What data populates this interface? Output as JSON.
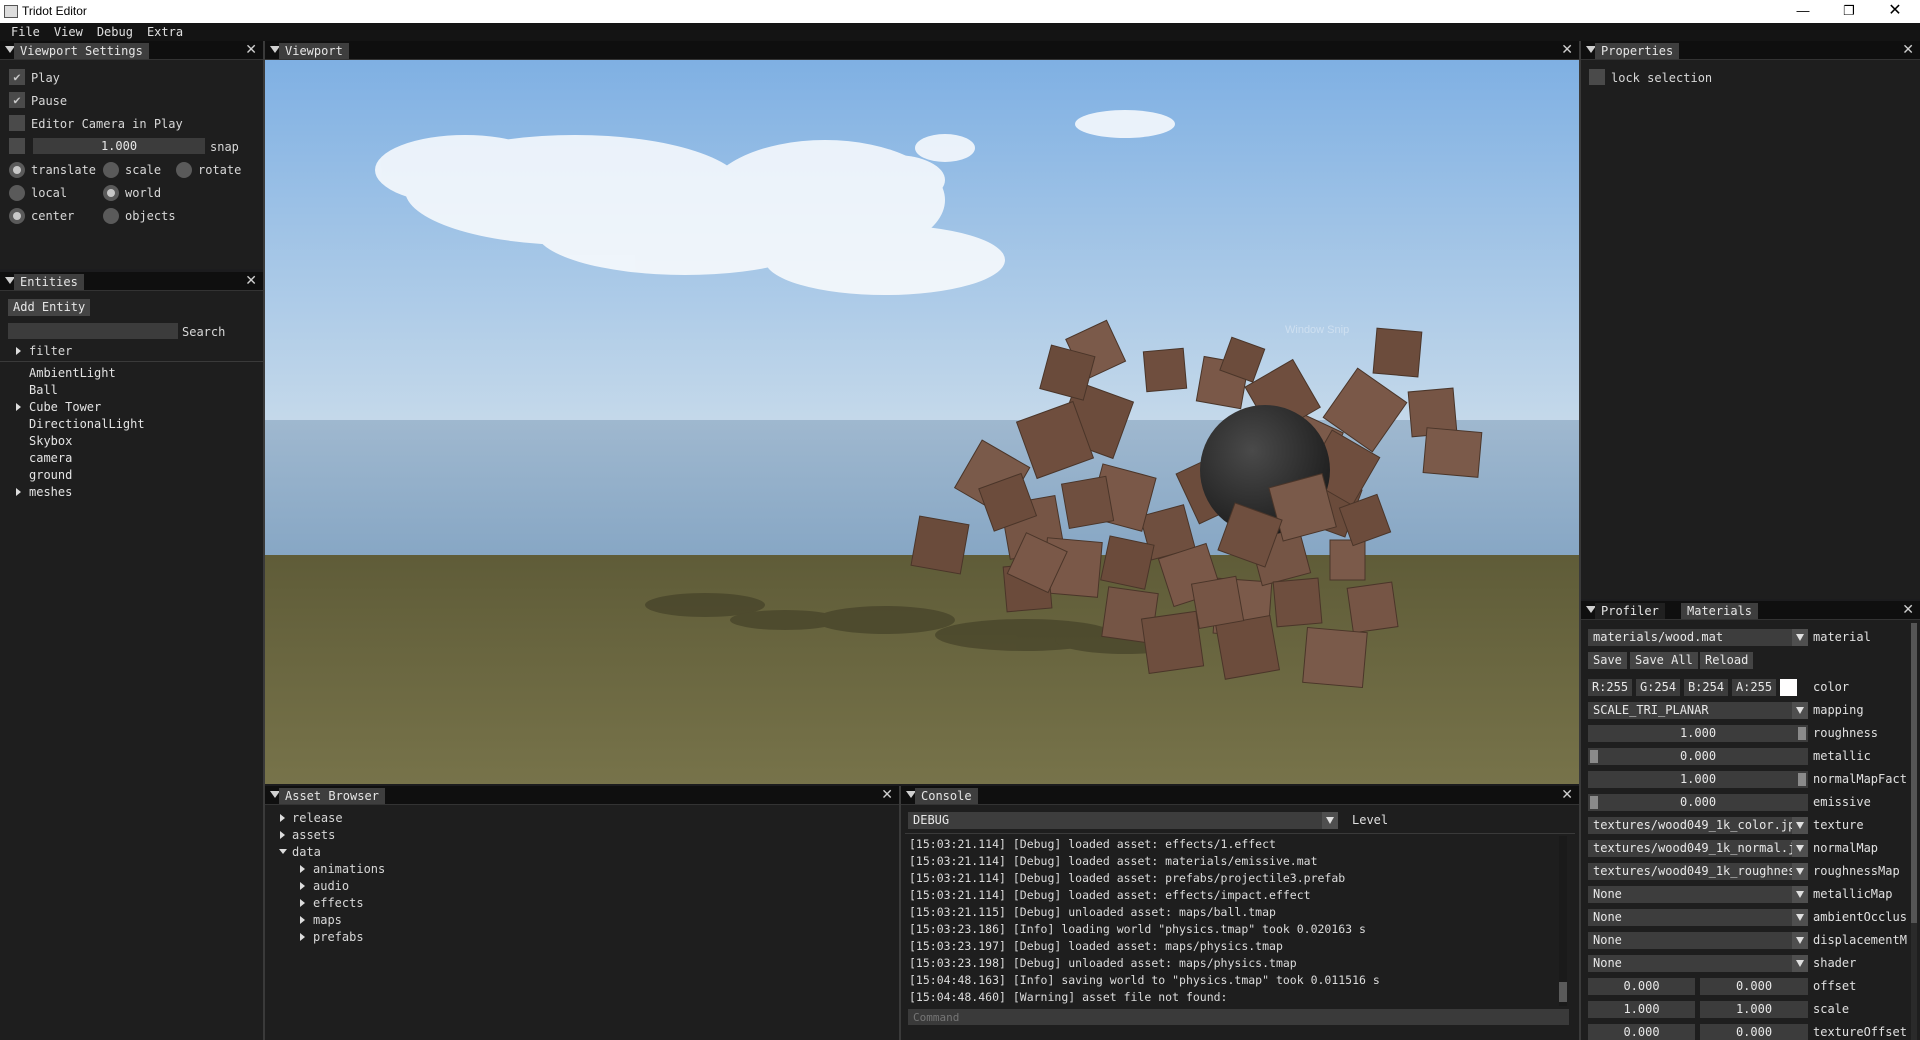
{
  "window": {
    "title": "Tridot Editor"
  },
  "menu": [
    "File",
    "View",
    "Debug",
    "Extra"
  ],
  "viewport_settings": {
    "tab": "Viewport Settings",
    "play": "Play",
    "pause": "Pause",
    "editor_camera": "Editor Camera in Play",
    "snap_value": "1.000",
    "snap": "snap",
    "translate": "translate",
    "scale": "scale",
    "rotate": "rotate",
    "local": "local",
    "world": "world",
    "center": "center",
    "objects": "objects"
  },
  "entities": {
    "tab": "Entities",
    "add_entity": "Add Entity",
    "search_label": "Search",
    "filter": "filter",
    "items": [
      "AmbientLight",
      "Ball",
      "Cube Tower",
      "DirectionalLight",
      "Skybox",
      "camera",
      "ground",
      "meshes"
    ]
  },
  "viewport": {
    "tab": "Viewport",
    "watermark": "Window Snip"
  },
  "properties": {
    "tab": "Properties",
    "lock_selection": "lock selection"
  },
  "materials_panel": {
    "tab_profiler": "Profiler",
    "tab_materials": "Materials",
    "material_path": "materials/wood.mat",
    "material_label": "material",
    "save": "Save",
    "save_all": "Save All",
    "reload": "Reload",
    "r": "R:255",
    "g": "G:254",
    "b": "B:254",
    "a": "A:255",
    "color_label": "color",
    "mapping_value": "SCALE_TRI_PLANAR",
    "mapping_label": "mapping",
    "roughness_value": "1.000",
    "roughness_label": "roughness",
    "roughness": 1.0,
    "metallic_value": "0.000",
    "metallic_label": "metallic",
    "metallic": 0.0,
    "normalmapfact_value": "1.000",
    "normalmapfact_label": "normalMapFact",
    "normalmapfact": 1.0,
    "emissive_value": "0.000",
    "emissive_label": "emissive",
    "emissive": 0.0,
    "texture_value": "textures/wood049_1k_color.jp",
    "texture_label": "texture",
    "normalmap_value": "textures/wood049_1k_normal.j",
    "normalmap_label": "normalMap",
    "roughnessmap_value": "textures/wood049_1k_roughnes",
    "roughnessmap_label": "roughnessMap",
    "metallicmap_value": "None",
    "metallicmap_label": "metallicMap",
    "ambientocclus_value": "None",
    "ambientocclus_label": "ambientOcclus",
    "displacement_value": "None",
    "displacement_label": "displacementM",
    "shader_value": "None",
    "shader_label": "shader",
    "offset_x": "0.000",
    "offset_y": "0.000",
    "offset_label": "offset",
    "scale_x": "1.000",
    "scale_y": "1.000",
    "scale_label": "scale",
    "toffset_x": "0.000",
    "toffset_y": "0.000",
    "toffset_label": "textureOffset"
  },
  "asset_browser": {
    "tab": "Asset Browser",
    "items": [
      "release",
      "assets",
      "data",
      "animations",
      "audio",
      "effects",
      "maps",
      "prefabs"
    ]
  },
  "console": {
    "tab": "Console",
    "level_value": "DEBUG",
    "level_label": "Level",
    "lines": [
      "[15:03:21.114] [Debug] loaded asset: effects/1.effect",
      "[15:03:21.114] [Debug] loaded asset: materials/emissive.mat",
      "[15:03:21.114] [Debug] loaded asset: prefabs/projectile3.prefab",
      "[15:03:21.114] [Debug] loaded asset: effects/impact.effect",
      "[15:03:21.115] [Debug] unloaded asset: maps/ball.tmap",
      "[15:03:23.186] [Info] loading world \"physics.tmap\" took 0.020163 s",
      "[15:03:23.197] [Debug] loaded asset: maps/physics.tmap",
      "[15:03:23.198] [Debug] unloaded asset: maps/physics.tmap",
      "[15:04:48.163] [Info] saving world to \"physics.tmap\" took 0.011516 s",
      "[15:04:48.460] [Warning] asset file not found:"
    ],
    "command_placeholder": "Command"
  },
  "colors": {
    "sky_top": "#86b3e0",
    "sky_horizon": "#c4d7e8",
    "ground": "#6d6a3f",
    "wood": "#6e4f3f",
    "ball": "#2c2c2c"
  }
}
